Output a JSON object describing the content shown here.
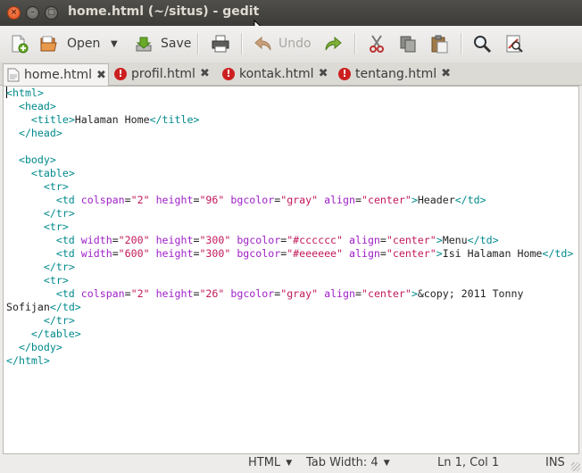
{
  "window": {
    "title": "home.html (~/situs) - gedit",
    "buttons": {
      "close": "×",
      "minimize": "–",
      "maximize": "□"
    }
  },
  "toolbar": {
    "new": {
      "icon": "new-document-icon"
    },
    "open": {
      "label": "Open",
      "icon": "folder-open-icon"
    },
    "save": {
      "label": "Save",
      "icon": "save-icon"
    },
    "print": {
      "icon": "printer-icon"
    },
    "undo": {
      "label": "Undo",
      "icon": "undo-arrow-icon",
      "enabled": false
    },
    "redo": {
      "icon": "redo-arrow-icon"
    },
    "cut": {
      "icon": "scissors-icon"
    },
    "copy": {
      "icon": "copy-icon"
    },
    "paste": {
      "icon": "clipboard-icon"
    },
    "find": {
      "icon": "magnifier-icon"
    },
    "replace": {
      "icon": "find-replace-icon"
    }
  },
  "tabs": [
    {
      "label": "home.html",
      "active": true,
      "icon": "document-icon"
    },
    {
      "label": "profil.html",
      "active": false,
      "icon": "error-icon"
    },
    {
      "label": "kontak.html",
      "active": false,
      "icon": "error-icon"
    },
    {
      "label": "tentang.html",
      "active": false,
      "icon": "error-icon"
    }
  ],
  "tab_close_glyph": "✖",
  "error_glyph": "!",
  "editor": {
    "lines": [
      "<html>",
      "  <head>",
      "    <title>Halaman Home</title>",
      "  </head>",
      "",
      "  <body>",
      "    <table>",
      "      <tr>",
      "        <td colspan=\"2\" height=\"96\" bgcolor=\"gray\" align=\"center\">Header</td>",
      "      </tr>",
      "      <tr>",
      "        <td width=\"200\" height=\"300\" bgcolor=\"#cccccc\" align=\"center\">Menu</td>",
      "        <td width=\"600\" height=\"300\" bgcolor=\"#eeeeee\" align=\"center\">Isi Halaman Home</td>",
      "      </tr>",
      "      <tr>",
      "        <td colspan=\"2\" height=\"26\" bgcolor=\"gray\" align=\"center\">&copy; 2011 Tonny",
      "Sofijan</td>",
      "      </tr>",
      "    </table>",
      "  </body>",
      "</html>"
    ],
    "colors": {
      "tag": "#008a8c",
      "attribute": "#a020c8",
      "string": "#c2185b",
      "text": "#222222"
    }
  },
  "statusbar": {
    "language": "HTML",
    "tab_width": "Tab Width:  4",
    "position": "Ln 1, Col 1",
    "mode": "INS"
  }
}
